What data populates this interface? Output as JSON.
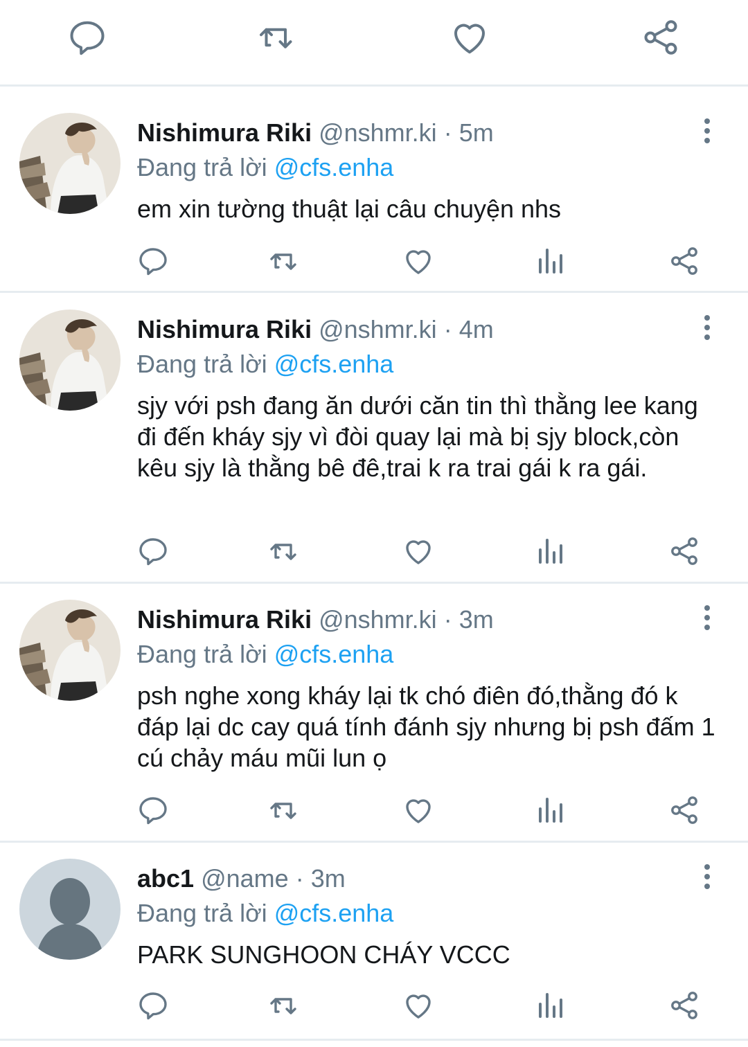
{
  "top_actions": [
    "reply-icon",
    "retweet-icon",
    "like-icon",
    "share-icon"
  ],
  "colors": {
    "mention": "#1da1f2",
    "muted": "#657786",
    "icon": "#657786",
    "separator": "#e6ecf0"
  },
  "tweets": [
    {
      "name": "Nishimura Riki",
      "handle": "@nshmr.ki",
      "time": "5m",
      "replying_prefix": "Đang trả lời ",
      "replying_to": "@cfs.enha",
      "text": "em xin tường thuật lại câu chuyện nhs",
      "avatar": "photo"
    },
    {
      "name": "Nishimura Riki",
      "handle": "@nshmr.ki",
      "time": "4m",
      "replying_prefix": "Đang trả lời ",
      "replying_to": "@cfs.enha",
      "text": "sjy với psh đang ăn dưới căn tin thì thằng lee kang đi đến kháy sjy vì đòi quay lại mà bị sjy block,còn kêu sjy là thằng bê đê,trai k ra trai gái k ra gái.",
      "avatar": "photo"
    },
    {
      "name": "Nishimura Riki",
      "handle": "@nshmr.ki",
      "time": "3m",
      "replying_prefix": "Đang trả lời ",
      "replying_to": "@cfs.enha",
      "text": "psh nghe xong kháy lại tk chó điên đó,thằng đó k đáp lại dc cay quá tính đánh sjy nhưng bị psh đấm 1 cú chảy máu mũi lun ọ",
      "avatar": "photo"
    },
    {
      "name": "abc1",
      "handle": "@name",
      "time": "3m",
      "replying_prefix": "Đang trả lời ",
      "replying_to": "@cfs.enha",
      "text": "PARK SUNGHOON CHÁY VCCC",
      "avatar": "default"
    }
  ]
}
